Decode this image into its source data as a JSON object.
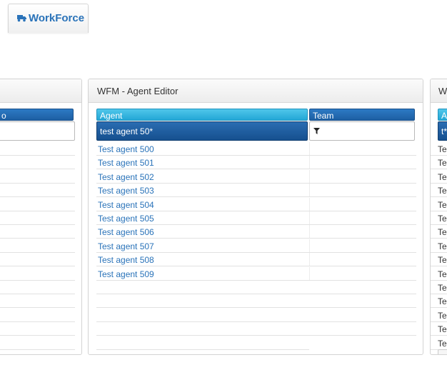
{
  "app": {
    "title": "WorkForce",
    "icon": "truck-icon",
    "accent": "#2a73b9"
  },
  "left_panel": {
    "header_fragment": "o"
  },
  "center_panel": {
    "title": "WFM - Agent Editor",
    "columns": [
      {
        "label": "Agent"
      },
      {
        "label": "Team"
      }
    ],
    "filter": {
      "agent_value": "test agent 50*",
      "team_icon": "filter-icon"
    },
    "rows": [
      "Test agent 500",
      "Test agent 501",
      "Test agent 502",
      "Test agent 503",
      "Test agent 504",
      "Test agent 505",
      "Test agent 506",
      "Test agent 507",
      "Test agent 508",
      "Test agent 509"
    ]
  },
  "right_panel": {
    "title_fragment": "W",
    "col_fragment": "Ag",
    "filter_fragment": "t*",
    "row_fragment": "Te",
    "pager_fragment": "«"
  }
}
